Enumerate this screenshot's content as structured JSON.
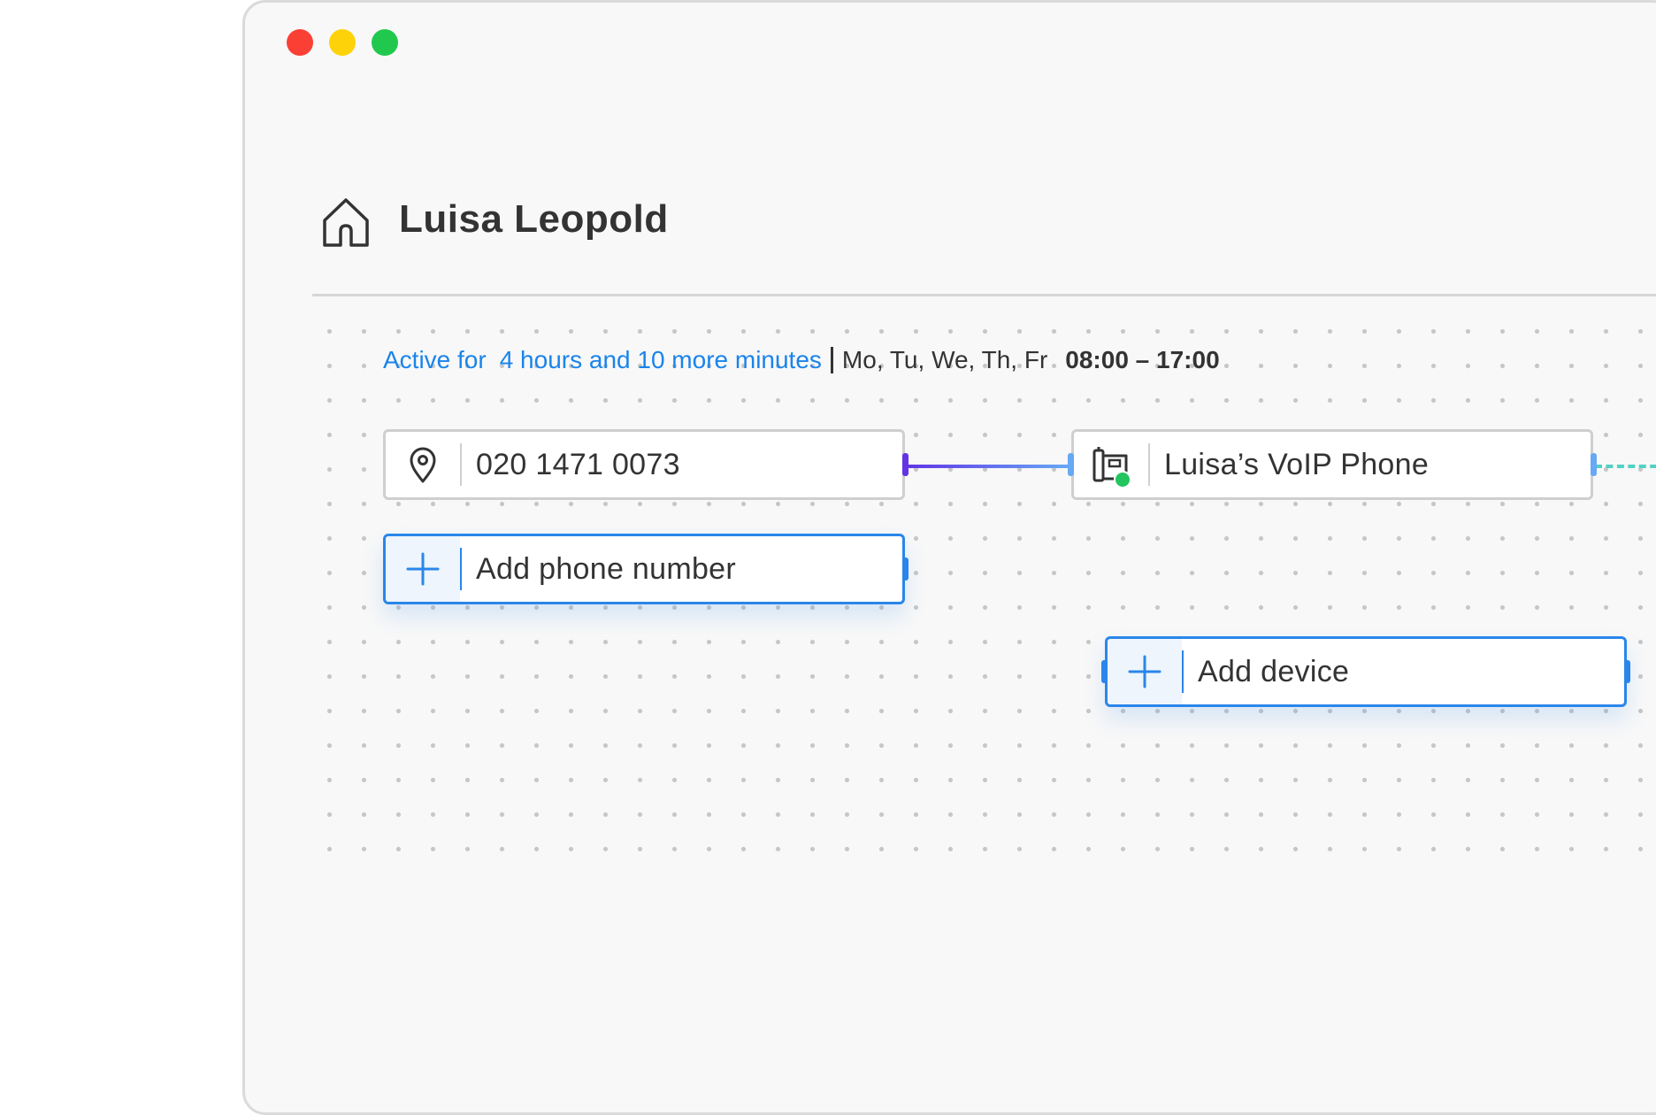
{
  "window": {
    "traffic_lights": [
      "close",
      "minimize",
      "zoom"
    ],
    "colors": {
      "close": "#fa4035",
      "minimize": "#fdd208",
      "zoom": "#21c84e"
    }
  },
  "header": {
    "icon": "home-icon",
    "title": "Luisa Leopold"
  },
  "schedule": {
    "active_prefix": "Active for",
    "active_duration": "4 hours and 10 more minutes",
    "days": "Mo, Tu, We, Th, Fr",
    "hours": "08:00 – 17:00",
    "accent_color": "#1a84ea"
  },
  "nodes": {
    "phone_number": {
      "icon": "location-pin-icon",
      "label": "020 1471 0073"
    },
    "add_phone": {
      "icon": "plus-icon",
      "label": "Add phone number"
    },
    "voip_device": {
      "icon": "desk-phone-icon",
      "label": "Luisa’s VoIP Phone",
      "status": "online"
    },
    "add_device": {
      "icon": "plus-icon",
      "label": "Add device"
    }
  }
}
